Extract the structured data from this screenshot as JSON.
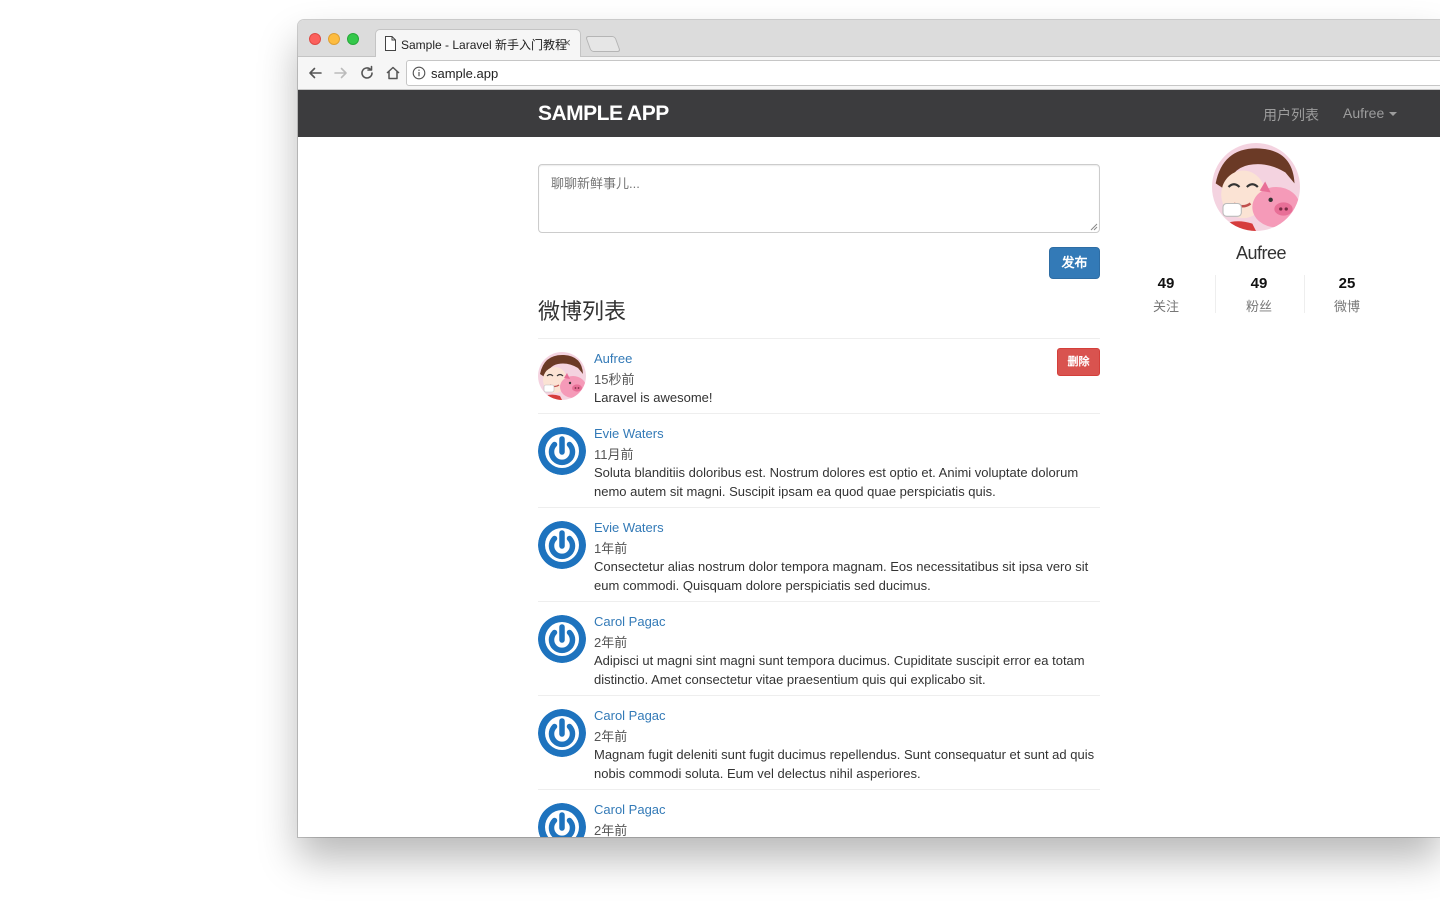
{
  "browser": {
    "tab_title": "Sample - Laravel 新手入门教程",
    "tab_close": "×",
    "url": "sample.app"
  },
  "navbar": {
    "brand": "SAMPLE APP",
    "users_link": "用户列表",
    "user_menu": "Aufree"
  },
  "composer": {
    "placeholder": "聊聊新鲜事儿...",
    "submit_label": "发布"
  },
  "feed": {
    "title": "微博列表",
    "delete_label": "删除",
    "statuses": [
      {
        "name": "Aufree",
        "time": "15秒前",
        "text": "Laravel is awesome!",
        "avatar": "cartoon"
      },
      {
        "name": "Evie Waters",
        "time": "11月前",
        "text": "Soluta blanditiis doloribus est. Nostrum dolores est optio et. Animi voluptate dolorum nemo autem sit magni. Suscipit ipsam ea quod quae perspiciatis quis.",
        "avatar": "gravatar"
      },
      {
        "name": "Evie Waters",
        "time": "1年前",
        "text": "Consectetur alias nostrum dolor tempora magnam. Eos necessitatibus sit ipsa vero sit eum commodi. Quisquam dolore perspiciatis sed ducimus.",
        "avatar": "gravatar"
      },
      {
        "name": "Carol Pagac",
        "time": "2年前",
        "text": "Adipisci ut magni sint magni sunt tempora ducimus. Cupiditate suscipit error ea totam distinctio. Amet consectetur vitae praesentium quis qui explicabo sit.",
        "avatar": "gravatar"
      },
      {
        "name": "Carol Pagac",
        "time": "2年前",
        "text": "Magnam fugit deleniti sunt fugit ducimus repellendus. Sunt consequatur et sunt ad quis nobis commodi soluta. Eum vel delectus nihil asperiores.",
        "avatar": "gravatar"
      },
      {
        "name": "Carol Pagac",
        "time": "2年前",
        "text": "",
        "avatar": "gravatar"
      }
    ]
  },
  "profile": {
    "name": "Aufree",
    "stats": [
      {
        "count": "49",
        "label": "关注"
      },
      {
        "count": "49",
        "label": "粉丝"
      },
      {
        "count": "25",
        "label": "微博"
      }
    ]
  },
  "colors": {
    "navbar": "#3c3c3e",
    "primary": "#337ab7",
    "danger": "#d9534f",
    "gravatar": "#1e73be"
  },
  "icons": [
    "document-icon",
    "back-arrow-icon",
    "forward-arrow-icon",
    "reload-icon",
    "home-icon",
    "info-icon",
    "caret-down-icon"
  ]
}
